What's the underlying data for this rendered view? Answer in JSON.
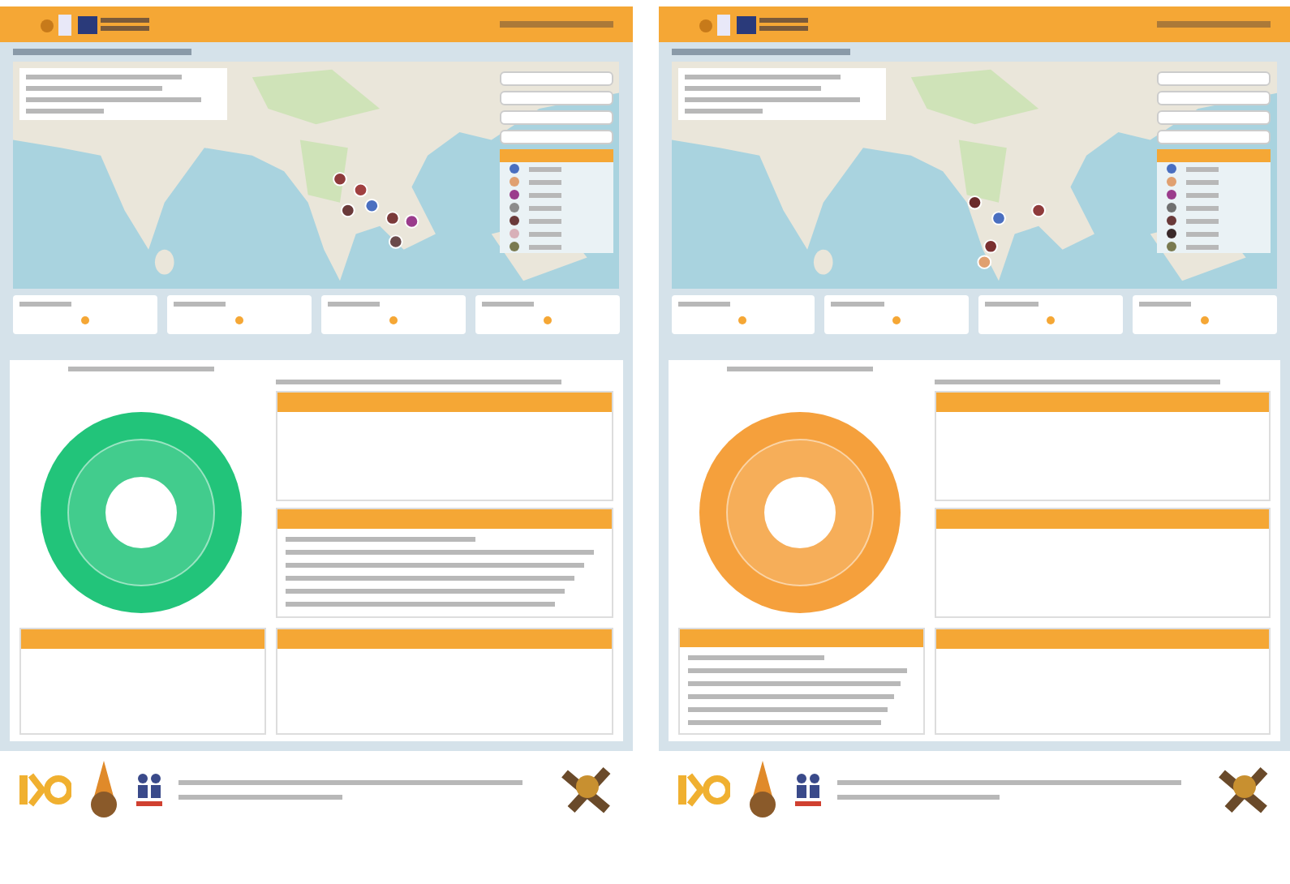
{
  "panels": [
    {
      "chart": {
        "color": "#22c47a"
      },
      "legend": [
        {
          "color": "#4a6fc0"
        },
        {
          "color": "#e0a070"
        },
        {
          "color": "#9a3c8c"
        },
        {
          "color": "#8c8c8c"
        },
        {
          "color": "#6a3a3a"
        },
        {
          "color": "#d8b0b8"
        },
        {
          "color": "#7a7a50"
        }
      ],
      "boxes": [
        {
          "kind": "empty"
        },
        {
          "kind": "lines"
        },
        {
          "kind": "empty"
        },
        {
          "kind": "empty"
        }
      ]
    },
    {
      "chart": {
        "color": "#f5a03c"
      },
      "legend": [
        {
          "color": "#4a6fc0"
        },
        {
          "color": "#e0a070"
        },
        {
          "color": "#9a3c8c"
        },
        {
          "color": "#707070"
        },
        {
          "color": "#6a3a3a"
        },
        {
          "color": "#3a2a2a"
        },
        {
          "color": "#7a7a50"
        }
      ],
      "boxes": [
        {
          "kind": "empty"
        },
        {
          "kind": "empty"
        },
        {
          "kind": "lines"
        },
        {
          "kind": "empty"
        }
      ]
    }
  ]
}
